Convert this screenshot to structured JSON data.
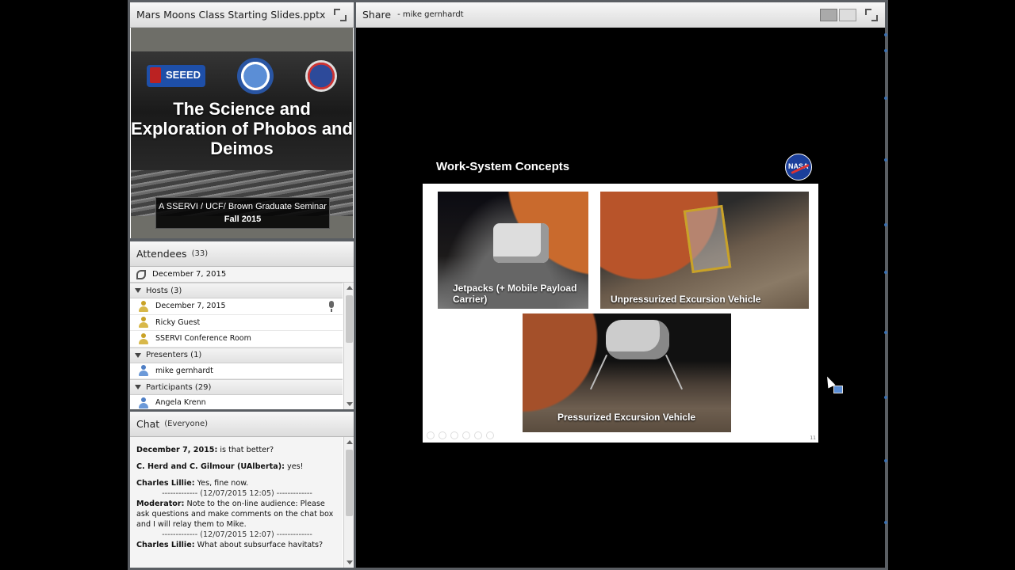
{
  "file_pod": {
    "title": "Mars Moons Class Starting Slides.pptx",
    "slide": {
      "logo_left": "SEEED",
      "title": "The Science and Exploration of Phobos and Deimos",
      "subtitle_line1": "A SSERVI / UCF/ Brown Graduate Seminar",
      "subtitle_line2": "Fall 2015"
    }
  },
  "attendees": {
    "title": "Attendees",
    "count": "(33)",
    "filter_label": "December 7, 2015",
    "groups": [
      {
        "label": "Hosts (3)",
        "members": [
          "December 7, 2015",
          "Ricky Guest",
          "SSERVI Conference Room"
        ]
      },
      {
        "label": "Presenters (1)",
        "members": [
          "mike gernhardt"
        ]
      },
      {
        "label": "Participants (29)",
        "members": [
          "Angela Krenn"
        ]
      }
    ]
  },
  "chat": {
    "title": "Chat",
    "scope": "(Everyone)",
    "messages": [
      {
        "sender": "December 7, 2015:",
        "text": " is that better?"
      },
      {
        "sender": "C. Herd and C. Gilmour (UAlberta):",
        "text": " yes!"
      },
      {
        "sender": "Charles Lillie:",
        "text": " Yes, fine now."
      },
      {
        "separator": "------------- (12/07/2015 12:05) -------------"
      },
      {
        "sender": "Moderator:",
        "text": " Note to the on-line audience:  Please ask questions and make comments on the chat box and I will relay them to Mike."
      },
      {
        "separator": "------------- (12/07/2015 12:07) -------------"
      },
      {
        "sender": "Charles Lillie:",
        "text": " What about subsurface havitats?"
      }
    ]
  },
  "share": {
    "title": "Share",
    "presenter": "- mike gernhardt",
    "slide": {
      "heading": "Work-System Concepts",
      "logo": "NASA",
      "captions": [
        "Jetpacks (+ Mobile Payload Carrier)",
        "Unpressurized Excursion Vehicle",
        "Pressurized Excursion Vehicle"
      ],
      "page_number": "11"
    }
  },
  "icons": [
    "maximize-icon",
    "phone-icon",
    "person-icon",
    "microphone-icon",
    "presenter-icon",
    "collapse-triangle-icon",
    "nasa-logo",
    "cursor-icon"
  ]
}
